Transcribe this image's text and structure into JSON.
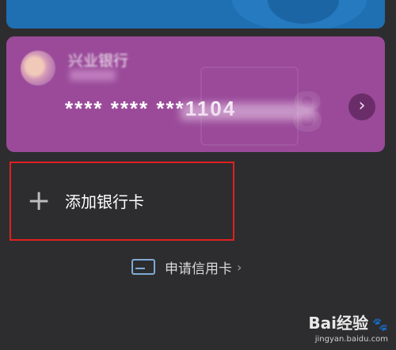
{
  "bank_card": {
    "bank_name": "兴业银行",
    "card_number": "****  ****  ***1104",
    "arrow": "›"
  },
  "add_card": {
    "icon": "+",
    "label": "添加银行卡"
  },
  "apply_credit": {
    "label": "申请信用卡",
    "chevron": "›"
  },
  "watermark": {
    "brand": "Bai经验",
    "url": "jingyan.baidu.com",
    "paw": "🐾"
  }
}
